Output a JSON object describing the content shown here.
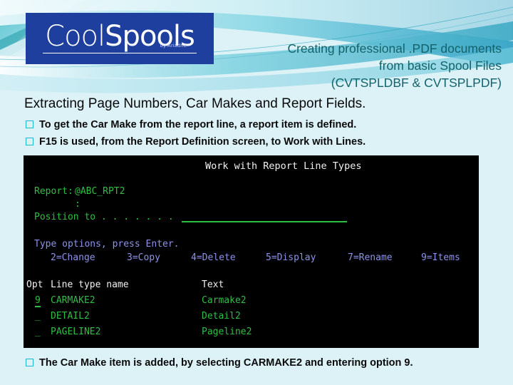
{
  "logo": {
    "text_cool": "Cool",
    "text_spools": "Spools",
    "byline": "by Ariadne"
  },
  "header": {
    "line1": "Creating professional .PDF documents",
    "line2": "from basic Spool Files",
    "line3": "(CVTSPLDBF & CVTSPLPDF)"
  },
  "slide": {
    "subtitle": "Extracting Page Numbers, Car Makes and Report Fields.",
    "bullets": [
      "To get the Car Make from the report line, a report item is defined.",
      "F15 is used, from the Report Definition screen, to Work with Lines.",
      "The Car Make item is added, by selecting CARMAKE2 and entering option 9."
    ]
  },
  "terminal": {
    "title": "Work with Report Line Types",
    "report_label": "Report:",
    "report_value": "@ABC_RPT2",
    "colon": ":",
    "position_label": "Position to . . . . . . .",
    "position_value": "",
    "instruction": "Type options, press Enter.",
    "options": [
      "2=Change",
      "3=Copy",
      "4=Delete",
      "5=Display",
      "7=Rename",
      "9=Items"
    ],
    "columns": {
      "opt": "Opt",
      "name": "Line type name",
      "text": "Text"
    },
    "rows": [
      {
        "opt": "9",
        "name": "CARMAKE2",
        "text": "Carmake2"
      },
      {
        "opt": "_",
        "name": "DETAIL2",
        "text": "Detail2"
      },
      {
        "opt": "_",
        "name": "PAGELINE2",
        "text": "Pageline2"
      }
    ]
  },
  "colors": {
    "background": "#dcf2f7",
    "logo_blue": "#1e3f9e",
    "header_teal": "#12636b",
    "bullet_square": "#1fb6cf",
    "terminal_green": "#2fbe44",
    "terminal_white": "#f2f2f2",
    "terminal_blue": "#8c93e8",
    "terminal_bg": "#000000"
  }
}
